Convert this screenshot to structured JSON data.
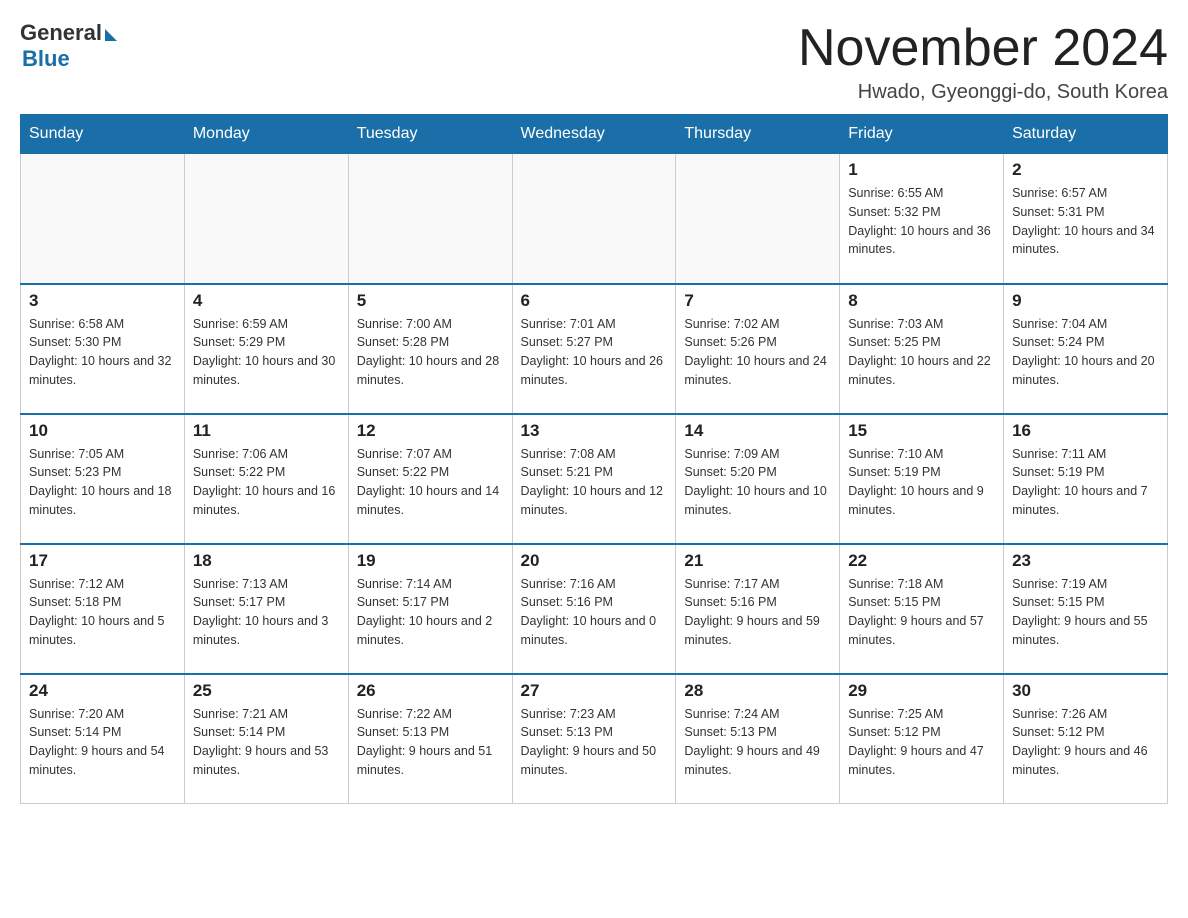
{
  "logo": {
    "general": "General",
    "blue": "Blue"
  },
  "title": "November 2024",
  "location": "Hwado, Gyeonggi-do, South Korea",
  "days_of_week": [
    "Sunday",
    "Monday",
    "Tuesday",
    "Wednesday",
    "Thursday",
    "Friday",
    "Saturday"
  ],
  "weeks": [
    [
      {
        "day": "",
        "info": ""
      },
      {
        "day": "",
        "info": ""
      },
      {
        "day": "",
        "info": ""
      },
      {
        "day": "",
        "info": ""
      },
      {
        "day": "",
        "info": ""
      },
      {
        "day": "1",
        "info": "Sunrise: 6:55 AM\nSunset: 5:32 PM\nDaylight: 10 hours and 36 minutes."
      },
      {
        "day": "2",
        "info": "Sunrise: 6:57 AM\nSunset: 5:31 PM\nDaylight: 10 hours and 34 minutes."
      }
    ],
    [
      {
        "day": "3",
        "info": "Sunrise: 6:58 AM\nSunset: 5:30 PM\nDaylight: 10 hours and 32 minutes."
      },
      {
        "day": "4",
        "info": "Sunrise: 6:59 AM\nSunset: 5:29 PM\nDaylight: 10 hours and 30 minutes."
      },
      {
        "day": "5",
        "info": "Sunrise: 7:00 AM\nSunset: 5:28 PM\nDaylight: 10 hours and 28 minutes."
      },
      {
        "day": "6",
        "info": "Sunrise: 7:01 AM\nSunset: 5:27 PM\nDaylight: 10 hours and 26 minutes."
      },
      {
        "day": "7",
        "info": "Sunrise: 7:02 AM\nSunset: 5:26 PM\nDaylight: 10 hours and 24 minutes."
      },
      {
        "day": "8",
        "info": "Sunrise: 7:03 AM\nSunset: 5:25 PM\nDaylight: 10 hours and 22 minutes."
      },
      {
        "day": "9",
        "info": "Sunrise: 7:04 AM\nSunset: 5:24 PM\nDaylight: 10 hours and 20 minutes."
      }
    ],
    [
      {
        "day": "10",
        "info": "Sunrise: 7:05 AM\nSunset: 5:23 PM\nDaylight: 10 hours and 18 minutes."
      },
      {
        "day": "11",
        "info": "Sunrise: 7:06 AM\nSunset: 5:22 PM\nDaylight: 10 hours and 16 minutes."
      },
      {
        "day": "12",
        "info": "Sunrise: 7:07 AM\nSunset: 5:22 PM\nDaylight: 10 hours and 14 minutes."
      },
      {
        "day": "13",
        "info": "Sunrise: 7:08 AM\nSunset: 5:21 PM\nDaylight: 10 hours and 12 minutes."
      },
      {
        "day": "14",
        "info": "Sunrise: 7:09 AM\nSunset: 5:20 PM\nDaylight: 10 hours and 10 minutes."
      },
      {
        "day": "15",
        "info": "Sunrise: 7:10 AM\nSunset: 5:19 PM\nDaylight: 10 hours and 9 minutes."
      },
      {
        "day": "16",
        "info": "Sunrise: 7:11 AM\nSunset: 5:19 PM\nDaylight: 10 hours and 7 minutes."
      }
    ],
    [
      {
        "day": "17",
        "info": "Sunrise: 7:12 AM\nSunset: 5:18 PM\nDaylight: 10 hours and 5 minutes."
      },
      {
        "day": "18",
        "info": "Sunrise: 7:13 AM\nSunset: 5:17 PM\nDaylight: 10 hours and 3 minutes."
      },
      {
        "day": "19",
        "info": "Sunrise: 7:14 AM\nSunset: 5:17 PM\nDaylight: 10 hours and 2 minutes."
      },
      {
        "day": "20",
        "info": "Sunrise: 7:16 AM\nSunset: 5:16 PM\nDaylight: 10 hours and 0 minutes."
      },
      {
        "day": "21",
        "info": "Sunrise: 7:17 AM\nSunset: 5:16 PM\nDaylight: 9 hours and 59 minutes."
      },
      {
        "day": "22",
        "info": "Sunrise: 7:18 AM\nSunset: 5:15 PM\nDaylight: 9 hours and 57 minutes."
      },
      {
        "day": "23",
        "info": "Sunrise: 7:19 AM\nSunset: 5:15 PM\nDaylight: 9 hours and 55 minutes."
      }
    ],
    [
      {
        "day": "24",
        "info": "Sunrise: 7:20 AM\nSunset: 5:14 PM\nDaylight: 9 hours and 54 minutes."
      },
      {
        "day": "25",
        "info": "Sunrise: 7:21 AM\nSunset: 5:14 PM\nDaylight: 9 hours and 53 minutes."
      },
      {
        "day": "26",
        "info": "Sunrise: 7:22 AM\nSunset: 5:13 PM\nDaylight: 9 hours and 51 minutes."
      },
      {
        "day": "27",
        "info": "Sunrise: 7:23 AM\nSunset: 5:13 PM\nDaylight: 9 hours and 50 minutes."
      },
      {
        "day": "28",
        "info": "Sunrise: 7:24 AM\nSunset: 5:13 PM\nDaylight: 9 hours and 49 minutes."
      },
      {
        "day": "29",
        "info": "Sunrise: 7:25 AM\nSunset: 5:12 PM\nDaylight: 9 hours and 47 minutes."
      },
      {
        "day": "30",
        "info": "Sunrise: 7:26 AM\nSunset: 5:12 PM\nDaylight: 9 hours and 46 minutes."
      }
    ]
  ]
}
